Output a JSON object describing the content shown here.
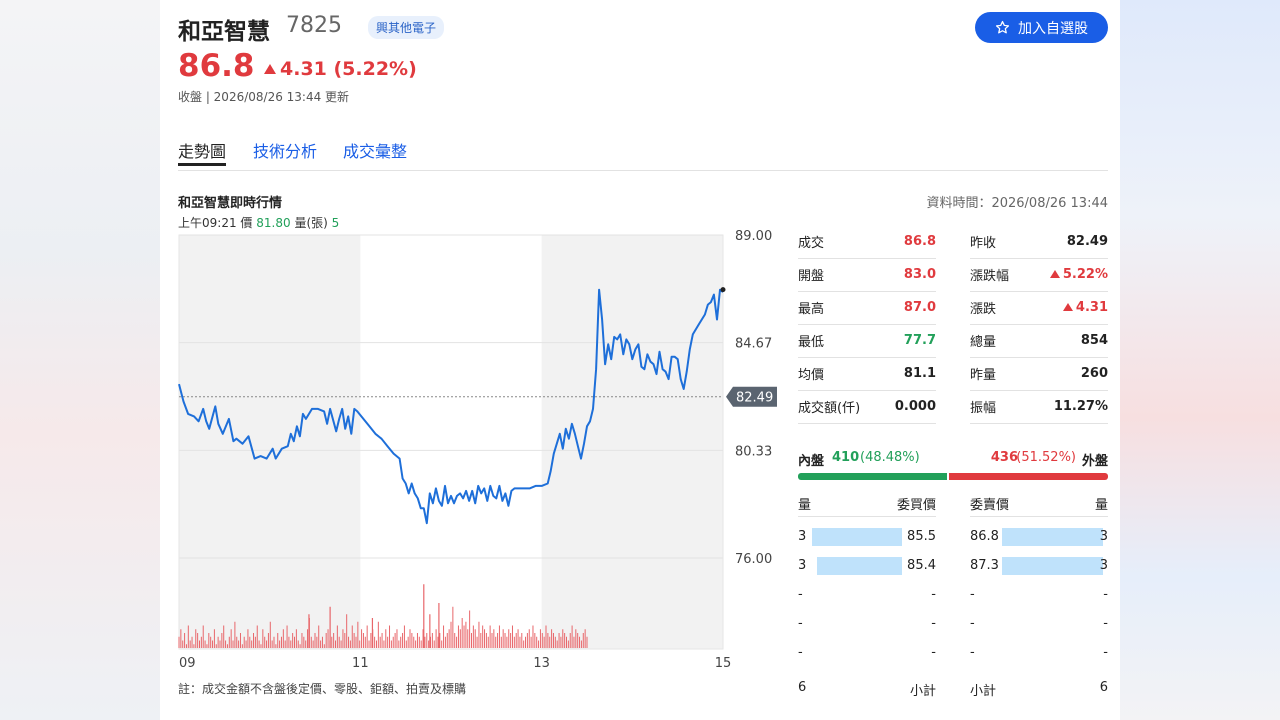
{
  "header": {
    "name": "和亞智慧",
    "code": "7825",
    "tag": "興其他電子",
    "watch_label": "加入自選股",
    "price": "86.8",
    "change": "4.31 (5.22%)",
    "status": "收盤 | 2026/08/26 13:44 更新"
  },
  "tabs": [
    "走勢圖",
    "技術分析",
    "成交彙整"
  ],
  "chart_section": {
    "title": "和亞智慧即時行情",
    "data_time": "資料時間：2026/08/26 13:44",
    "info_time": "上午09:21",
    "info_price_label": "價",
    "info_price": "81.80",
    "info_vol_label": "量(張)",
    "info_vol": "5",
    "note": "註：成交金額不含盤後定價、零股、鉅額、拍賣及標購"
  },
  "chart_data": {
    "type": "line",
    "x_ticks": [
      "09",
      "11",
      "13",
      "15"
    ],
    "y_ticks": [
      "89.00",
      "84.67",
      "80.33",
      "76.00"
    ],
    "ylim": [
      76.0,
      89.0
    ],
    "reference_label": "82.49",
    "reference": 82.49,
    "x_domain_minutes": [
      0,
      360
    ],
    "series": [
      {
        "points": [
          [
            0,
            83.0
          ],
          [
            3,
            82.3
          ],
          [
            6,
            81.8
          ],
          [
            10,
            81.7
          ],
          [
            13,
            81.5
          ],
          [
            16,
            82.0
          ],
          [
            18,
            81.5
          ],
          [
            20,
            81.2
          ],
          [
            24,
            82.1
          ],
          [
            26,
            81.4
          ],
          [
            29,
            81.0
          ],
          [
            33,
            81.6
          ],
          [
            36,
            80.7
          ],
          [
            38,
            80.8
          ],
          [
            42,
            80.6
          ],
          [
            46,
            80.9
          ],
          [
            50,
            80.0
          ],
          [
            54,
            80.1
          ],
          [
            58,
            80.0
          ],
          [
            62,
            80.4
          ],
          [
            64,
            80.0
          ],
          [
            68,
            80.4
          ],
          [
            72,
            80.5
          ],
          [
            74,
            81.0
          ],
          [
            76,
            80.7
          ],
          [
            78,
            81.3
          ],
          [
            80,
            80.9
          ],
          [
            82,
            81.8
          ],
          [
            84,
            81.6
          ],
          [
            88,
            82.0
          ],
          [
            92,
            82.0
          ],
          [
            96,
            81.9
          ],
          [
            98,
            81.4
          ],
          [
            100,
            82.0
          ],
          [
            104,
            81.1
          ],
          [
            106,
            81.6
          ],
          [
            108,
            82.0
          ],
          [
            110,
            81.2
          ],
          [
            112,
            81.7
          ],
          [
            114,
            81.0
          ],
          [
            116,
            82.0
          ],
          [
            118,
            81.9
          ],
          [
            122,
            81.6
          ],
          [
            126,
            81.3
          ],
          [
            130,
            81.0
          ],
          [
            134,
            80.8
          ],
          [
            138,
            80.5
          ],
          [
            142,
            80.2
          ],
          [
            146,
            80.0
          ],
          [
            148,
            79.2
          ],
          [
            150,
            79.0
          ],
          [
            152,
            78.6
          ],
          [
            154,
            79.0
          ],
          [
            156,
            78.6
          ],
          [
            158,
            78.4
          ],
          [
            160,
            78.0
          ],
          [
            162,
            78.0
          ],
          [
            164,
            77.4
          ],
          [
            166,
            78.6
          ],
          [
            168,
            78.2
          ],
          [
            170,
            78.8
          ],
          [
            172,
            78.3
          ],
          [
            174,
            78.1
          ],
          [
            176,
            78.9
          ],
          [
            178,
            78.2
          ],
          [
            180,
            78.5
          ],
          [
            182,
            78.2
          ],
          [
            184,
            78.5
          ],
          [
            186,
            78.6
          ],
          [
            188,
            78.4
          ],
          [
            190,
            78.7
          ],
          [
            192,
            78.3
          ],
          [
            194,
            78.7
          ],
          [
            196,
            78.2
          ],
          [
            198,
            78.9
          ],
          [
            200,
            78.6
          ],
          [
            202,
            78.8
          ],
          [
            204,
            78.3
          ],
          [
            206,
            78.9
          ],
          [
            208,
            78.5
          ],
          [
            210,
            78.4
          ],
          [
            212,
            78.9
          ],
          [
            214,
            78.3
          ],
          [
            216,
            78.6
          ],
          [
            218,
            78.1
          ],
          [
            220,
            78.7
          ],
          [
            222,
            78.8
          ],
          [
            224,
            78.8
          ],
          [
            228,
            78.8
          ],
          [
            232,
            78.8
          ],
          [
            236,
            78.9
          ],
          [
            240,
            78.9
          ],
          [
            244,
            79.0
          ],
          [
            246,
            79.5
          ],
          [
            248,
            80.2
          ],
          [
            250,
            80.6
          ],
          [
            252,
            81.0
          ],
          [
            254,
            80.4
          ],
          [
            256,
            81.2
          ],
          [
            258,
            80.8
          ],
          [
            260,
            81.4
          ],
          [
            262,
            81.0
          ],
          [
            264,
            80.5
          ],
          [
            266,
            80.0
          ],
          [
            268,
            80.6
          ],
          [
            270,
            81.3
          ],
          [
            272,
            81.5
          ],
          [
            274,
            82.0
          ],
          [
            276,
            83.6
          ],
          [
            278,
            86.8
          ],
          [
            280,
            85.6
          ],
          [
            282,
            83.8
          ],
          [
            284,
            84.6
          ],
          [
            286,
            84.0
          ],
          [
            288,
            84.9
          ],
          [
            290,
            84.8
          ],
          [
            292,
            85.0
          ],
          [
            294,
            84.2
          ],
          [
            296,
            84.8
          ],
          [
            298,
            84.6
          ],
          [
            300,
            84.0
          ],
          [
            302,
            84.4
          ],
          [
            304,
            84.6
          ],
          [
            306,
            83.7
          ],
          [
            308,
            83.6
          ],
          [
            310,
            84.2
          ],
          [
            312,
            83.9
          ],
          [
            314,
            83.8
          ],
          [
            316,
            83.4
          ],
          [
            318,
            84.3
          ],
          [
            320,
            83.6
          ],
          [
            322,
            83.5
          ],
          [
            324,
            83.2
          ],
          [
            326,
            84.1
          ],
          [
            328,
            84.1
          ],
          [
            330,
            84.0
          ],
          [
            332,
            83.2
          ],
          [
            334,
            82.8
          ],
          [
            336,
            83.5
          ],
          [
            338,
            84.4
          ],
          [
            340,
            85.0
          ],
          [
            342,
            85.2
          ],
          [
            344,
            85.4
          ],
          [
            346,
            85.6
          ],
          [
            348,
            85.8
          ],
          [
            350,
            86.2
          ],
          [
            352,
            86.3
          ],
          [
            354,
            86.6
          ],
          [
            356,
            85.6
          ],
          [
            358,
            86.8
          ],
          [
            360,
            86.7
          ]
        ],
        "last_marker": [
          360,
          86.8
        ]
      }
    ],
    "volume": {
      "series_ylim": [
        0,
        20
      ],
      "values": [
        3,
        5,
        2,
        4,
        1,
        6,
        2,
        3,
        1,
        5,
        4,
        2,
        3,
        6,
        2,
        1,
        4,
        3,
        2,
        5,
        1,
        3,
        2,
        4,
        6,
        2,
        1,
        3,
        5,
        2,
        7,
        3,
        2,
        4,
        1,
        3,
        2,
        5,
        3,
        2,
        4,
        3,
        6,
        2,
        1,
        5,
        3,
        2,
        4,
        7,
        2,
        3,
        1,
        4,
        2,
        3,
        5,
        2,
        6,
        3,
        2,
        4,
        3,
        5,
        2,
        1,
        4,
        3,
        2,
        5,
        8,
        3,
        2,
        4,
        3,
        6,
        2,
        3,
        1,
        4,
        5,
        2,
        3,
        4,
        2,
        6,
        3,
        2,
        5,
        4,
        9,
        3,
        2,
        6,
        4,
        3,
        7,
        2,
        5,
        4,
        3,
        6,
        2,
        4,
        5,
        3,
        2,
        7,
        3,
        4,
        2,
        5,
        3,
        6,
        2,
        3,
        4,
        5,
        2,
        3,
        4,
        6,
        2,
        3,
        5,
        4,
        3,
        2,
        4,
        3,
        2,
        5,
        3,
        4,
        2,
        3,
        4,
        2,
        5,
        3,
        4,
        2,
        6,
        3,
        4,
        5,
        7,
        11,
        4,
        3,
        6,
        5,
        8,
        6,
        7,
        5,
        10,
        4,
        6,
        5,
        3,
        7,
        4,
        6,
        5,
        4,
        3,
        6,
        4,
        5,
        3,
        4,
        6,
        3,
        5,
        4,
        3,
        5,
        4,
        6,
        3,
        4,
        5,
        3,
        4,
        2,
        3,
        4,
        5,
        3,
        6,
        4,
        3,
        2,
        5,
        4,
        3,
        6,
        4,
        3,
        5,
        4,
        3,
        2,
        4,
        3,
        5,
        4,
        3,
        2,
        4,
        6,
        3,
        5,
        4,
        3,
        2,
        4,
        5,
        3
      ],
      "tall_spikes": [
        [
          100,
          11
        ],
        [
          162,
          17
        ],
        [
          172,
          12
        ],
        [
          166,
          9
        ],
        [
          128,
          8
        ],
        [
          86,
          9
        ]
      ]
    }
  },
  "stats": [
    {
      "label": "成交",
      "value": "86.8",
      "color": "red"
    },
    {
      "label": "昨收",
      "value": "82.49",
      "color": "blk"
    },
    {
      "label": "開盤",
      "value": "83.0",
      "color": "red"
    },
    {
      "label": "漲跌幅",
      "value": "5.22%",
      "color": "red",
      "arrow": true
    },
    {
      "label": "最高",
      "value": "87.0",
      "color": "red"
    },
    {
      "label": "漲跌",
      "value": "4.31",
      "color": "red",
      "arrow": true
    },
    {
      "label": "最低",
      "value": "77.7",
      "color": "green"
    },
    {
      "label": "總量",
      "value": "854",
      "color": "blk"
    },
    {
      "label": "均價",
      "value": "81.1",
      "color": "blk"
    },
    {
      "label": "昨量",
      "value": "260",
      "color": "blk"
    },
    {
      "label": "成交額(仟)",
      "value": "0.000",
      "color": "blk"
    },
    {
      "label": "振幅",
      "value": "11.27%",
      "color": "blk"
    }
  ],
  "inner_outer": {
    "inner_label": "內盤",
    "inner_value": "410",
    "inner_pct": "(48.48%)",
    "outer_value": "436",
    "outer_pct": "(51.52%)",
    "outer_label": "外盤",
    "inner_fraction": 0.4848
  },
  "orderbook": {
    "headers": {
      "bid_qty": "量",
      "bid_price": "委買價",
      "ask_price": "委賣價",
      "ask_qty": "量"
    },
    "rows": [
      {
        "bid_qty": "3",
        "bid_price": "85.5",
        "ask_price": "86.8",
        "ask_qty": "3",
        "bid_fill": 0.9,
        "ask_fill": 0.95
      },
      {
        "bid_qty": "3",
        "bid_price": "85.4",
        "ask_price": "87.3",
        "ask_qty": "3",
        "bid_fill": 0.85,
        "ask_fill": 0.95
      },
      {
        "bid_qty": "-",
        "bid_price": "-",
        "ask_price": "-",
        "ask_qty": "-"
      },
      {
        "bid_qty": "-",
        "bid_price": "-",
        "ask_price": "-",
        "ask_qty": "-"
      },
      {
        "bid_qty": "-",
        "bid_price": "-",
        "ask_price": "-",
        "ask_qty": "-"
      }
    ],
    "footer": {
      "bid_total": "6",
      "bid_label": "小計",
      "ask_label": "小計",
      "ask_total": "6"
    }
  },
  "colors": {
    "up": "#e03a3e",
    "down": "#22a05a",
    "accent": "#1a5ee6",
    "line": "#1e6fd9"
  }
}
